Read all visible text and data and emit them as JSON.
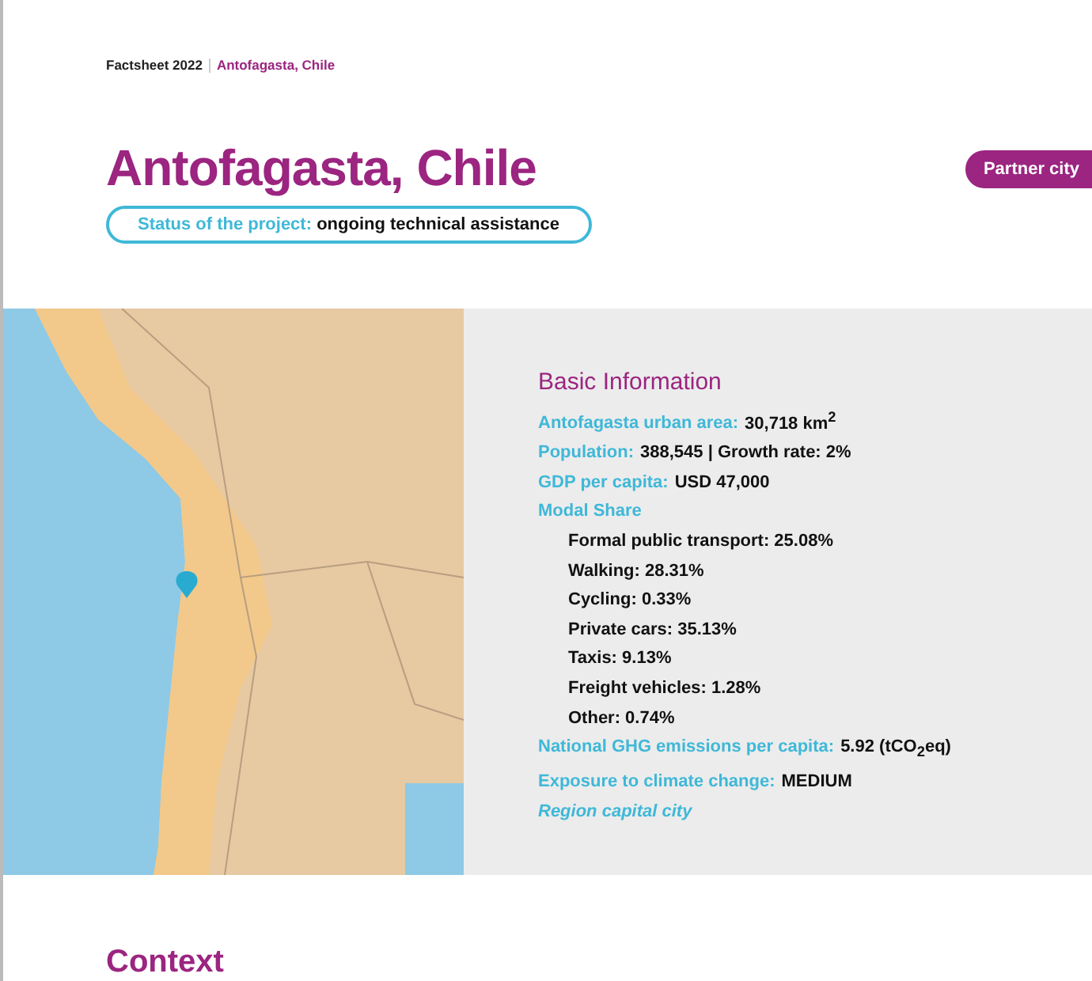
{
  "breadcrumb": {
    "doc": "Factsheet 2022",
    "city": "Antofagasta, Chile"
  },
  "title": "Antofagasta, Chile",
  "badge": "Partner city",
  "status": {
    "label": "Status of the project:",
    "value": "ongoing technical assistance"
  },
  "basic_info": {
    "heading": "Basic Information",
    "rows": [
      {
        "kind": "field",
        "label": "Antofagasta urban area:",
        "value": "30,718 km$^{2}$"
      },
      {
        "kind": "field",
        "label": "Population:",
        "value": "388,545 | Growth rate: 2%"
      },
      {
        "kind": "field",
        "label": "GDP per capita:",
        "value": "USD 47,000"
      },
      {
        "kind": "field",
        "label": "Modal Share"
      },
      {
        "kind": "item",
        "value": "Formal public transport: 25.08%"
      },
      {
        "kind": "item",
        "value": "Walking: 28.31%"
      },
      {
        "kind": "item",
        "value": "Cycling: 0.33%"
      },
      {
        "kind": "item",
        "value": "Private cars: 35.13%"
      },
      {
        "kind": "item",
        "value": "Taxis: 9.13%"
      },
      {
        "kind": "item",
        "value": "Freight vehicles: 1.28%"
      },
      {
        "kind": "item",
        "value": "Other: 0.74%"
      },
      {
        "kind": "field",
        "label": "National GHG emissions per capita:",
        "value": "5.92 (tCO$_{2}$eq)"
      },
      {
        "kind": "field",
        "label": "Exposure to climate change:",
        "value": "MEDIUM"
      },
      {
        "kind": "note",
        "value": "Region capital city"
      }
    ]
  },
  "next_section": "Context"
}
